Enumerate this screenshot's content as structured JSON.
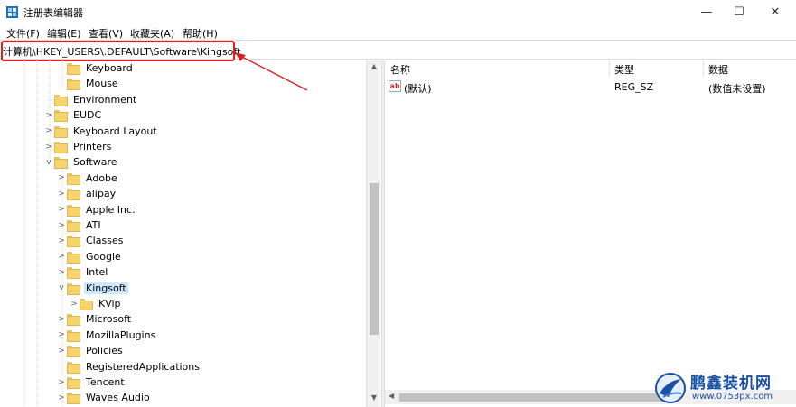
{
  "window": {
    "title": "注册表编辑器",
    "controls": {
      "minimize": "—",
      "maximize": "☐",
      "close": "✕"
    }
  },
  "menu": {
    "items": [
      {
        "label": "文件(F)"
      },
      {
        "label": "编辑(E)"
      },
      {
        "label": "查看(V)"
      },
      {
        "label": "收藏夹(A)"
      },
      {
        "label": "帮助(H)"
      }
    ]
  },
  "address": {
    "path": "计算机\\HKEY_USERS\\.DEFAULT\\Software\\Kingsoft",
    "highlight_color": "#e02020"
  },
  "tree": {
    "items": [
      {
        "label": "Keyboard",
        "level": 3,
        "expander": ""
      },
      {
        "label": "Mouse",
        "level": 3,
        "expander": ""
      },
      {
        "label": "Environment",
        "level": 2,
        "expander": ""
      },
      {
        "label": "EUDC",
        "level": 2,
        "expander": ">"
      },
      {
        "label": "Keyboard Layout",
        "level": 2,
        "expander": ">"
      },
      {
        "label": "Printers",
        "level": 2,
        "expander": ">"
      },
      {
        "label": "Software",
        "level": 2,
        "expander": "v"
      },
      {
        "label": "Adobe",
        "level": 3,
        "expander": ">"
      },
      {
        "label": "alipay",
        "level": 3,
        "expander": ">"
      },
      {
        "label": "Apple Inc.",
        "level": 3,
        "expander": ">"
      },
      {
        "label": "ATI",
        "level": 3,
        "expander": ">"
      },
      {
        "label": "Classes",
        "level": 3,
        "expander": ">"
      },
      {
        "label": "Google",
        "level": 3,
        "expander": ">"
      },
      {
        "label": "Intel",
        "level": 3,
        "expander": ">"
      },
      {
        "label": "Kingsoft",
        "level": 3,
        "expander": "v",
        "selected": true
      },
      {
        "label": "KVip",
        "level": 4,
        "expander": ">"
      },
      {
        "label": "Microsoft",
        "level": 3,
        "expander": ">"
      },
      {
        "label": "MozillaPlugins",
        "level": 3,
        "expander": ">"
      },
      {
        "label": "Policies",
        "level": 3,
        "expander": ">"
      },
      {
        "label": "RegisteredApplications",
        "level": 3,
        "expander": ""
      },
      {
        "label": "Tencent",
        "level": 3,
        "expander": ">"
      },
      {
        "label": "Waves Audio",
        "level": 3,
        "expander": ">"
      }
    ],
    "selected_color": "#cce8ff",
    "folder_color": "#f6d46d"
  },
  "list": {
    "columns": [
      {
        "label": "名称"
      },
      {
        "label": "类型"
      },
      {
        "label": "数据"
      }
    ],
    "rows": [
      {
        "icon": "ab-string-icon",
        "icon_text": "ab",
        "name": "(默认)",
        "type": "REG_SZ",
        "data": "(数值未设置)"
      }
    ]
  },
  "watermark": {
    "title": "鹏鑫装机网",
    "url": "www.0753px.com"
  }
}
